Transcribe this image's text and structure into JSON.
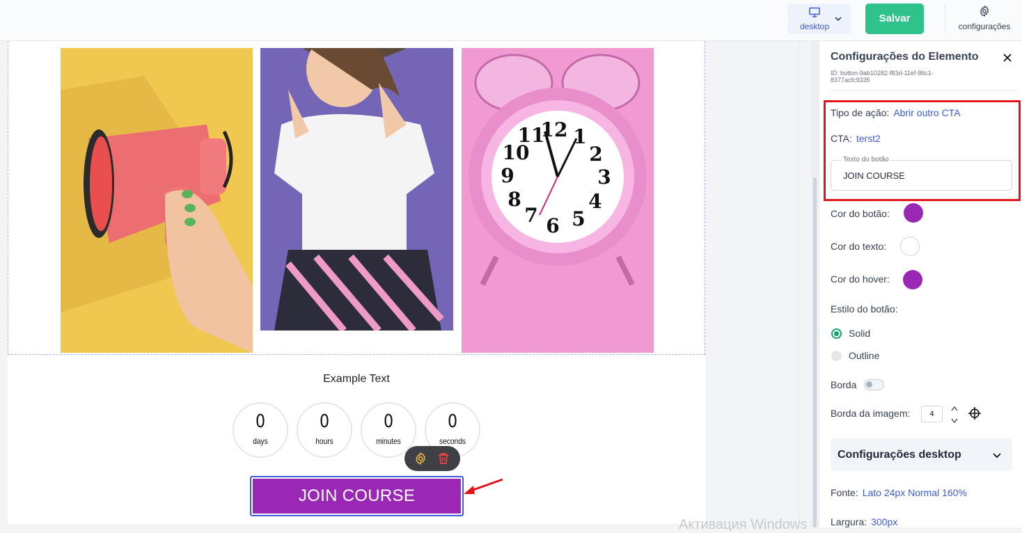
{
  "topbar": {
    "device_label": "desktop",
    "save_label": "Salvar",
    "settings_label": "configurações"
  },
  "canvas": {
    "example_text": "Example Text",
    "countdown": [
      {
        "value": "0",
        "unit": "days"
      },
      {
        "value": "0",
        "unit": "hours"
      },
      {
        "value": "0",
        "unit": "minutes"
      },
      {
        "value": "0",
        "unit": "seconds"
      }
    ],
    "join_button": "JOIN COURSE"
  },
  "panel": {
    "title": "Configurações do Elemento",
    "element_id": "ID: button-9ab10282-f83d-11ef-86c1-8377acfc9335",
    "action_type_label": "Tipo de ação:",
    "action_type_value": "Abrir outro CTA",
    "cta_label": "CTA:",
    "cta_value": "terst2",
    "button_text_label": "Texto do botão",
    "button_text_value": "JOIN COURSE",
    "button_color_label": "Cor do botão:",
    "text_color_label": "Cor do texto:",
    "hover_color_label": "Cor do hover:",
    "button_style_label": "Estilo do botão:",
    "style_solid": "Solid",
    "style_outline": "Outline",
    "border_label": "Borda",
    "image_border_label": "Borda da imagem:",
    "image_border_value": "4",
    "desktop_settings": "Configurações desktop",
    "font_label": "Fonte:",
    "font_value": "Lato 24px Normal 160%",
    "width_label": "Largura:",
    "width_value": "300px"
  },
  "colors": {
    "button_color": "#9b27b5",
    "text_color": "#ffffff",
    "hover_color": "#9b27b5",
    "accent": "#3b5bdb",
    "save": "#2fc28a"
  },
  "watermark": "Активация Windows"
}
